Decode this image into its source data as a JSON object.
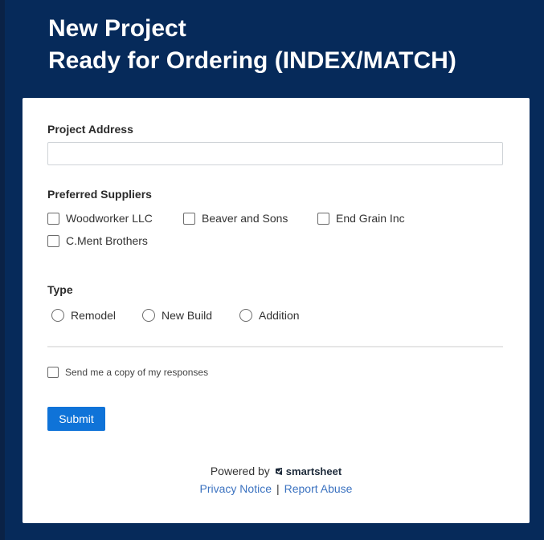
{
  "header": {
    "line1": "New Project",
    "line2": "Ready for Ordering (INDEX/MATCH)"
  },
  "form": {
    "address_label": "Project Address",
    "address_value": "",
    "suppliers_label": "Preferred Suppliers",
    "suppliers": [
      "Woodworker LLC",
      "Beaver and Sons",
      "End Grain Inc",
      "C.Ment Brothers"
    ],
    "type_label": "Type",
    "types": [
      "Remodel",
      "New Build",
      "Addition"
    ],
    "copy_label": "Send me a copy of my responses",
    "submit_label": "Submit"
  },
  "footer": {
    "powered_by": "Powered by",
    "brand": "smartsheet",
    "privacy": "Privacy Notice",
    "separator": "|",
    "report": "Report Abuse"
  },
  "colors": {
    "background": "#062a5a",
    "accent": "#0f73d8",
    "link": "#3b72c0"
  }
}
